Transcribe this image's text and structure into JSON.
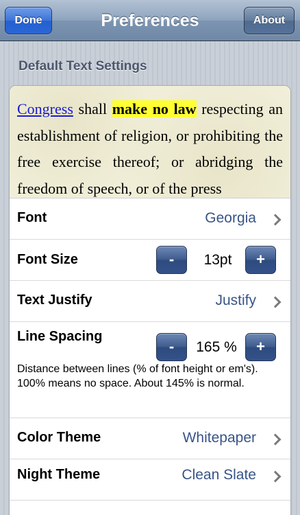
{
  "nav": {
    "title": "Preferences",
    "done_label": "Done",
    "about_label": "About"
  },
  "section": {
    "header": "Default Text Settings"
  },
  "preview": {
    "link_word": "Congress",
    "word_shall": "shall",
    "highlight": "make no law",
    "rest": "respecting an establishment of religion, or prohibiting the free exercise thereof; or abridging the freedom of speech, or of the press"
  },
  "settings": {
    "font": {
      "label": "Font",
      "value": "Georgia"
    },
    "font_size": {
      "label": "Font Size",
      "value": "13pt",
      "minus": "-",
      "plus": "+"
    },
    "text_justify": {
      "label": "Text Justify",
      "value": "Justify"
    },
    "line_spacing": {
      "label": "Line Spacing",
      "value": "165 %",
      "minus": "-",
      "plus": "+",
      "description": "Distance between lines (% of font height or em's).  100% means no space.  About 145% is normal."
    },
    "color_theme": {
      "label": "Color Theme",
      "value": "Whitepaper"
    },
    "night_theme": {
      "label": "Night Theme",
      "value": "Clean Slate"
    }
  },
  "colors": {
    "accent_value": "#385487",
    "highlight": "#ffff33",
    "link": "#1a1ad0"
  }
}
